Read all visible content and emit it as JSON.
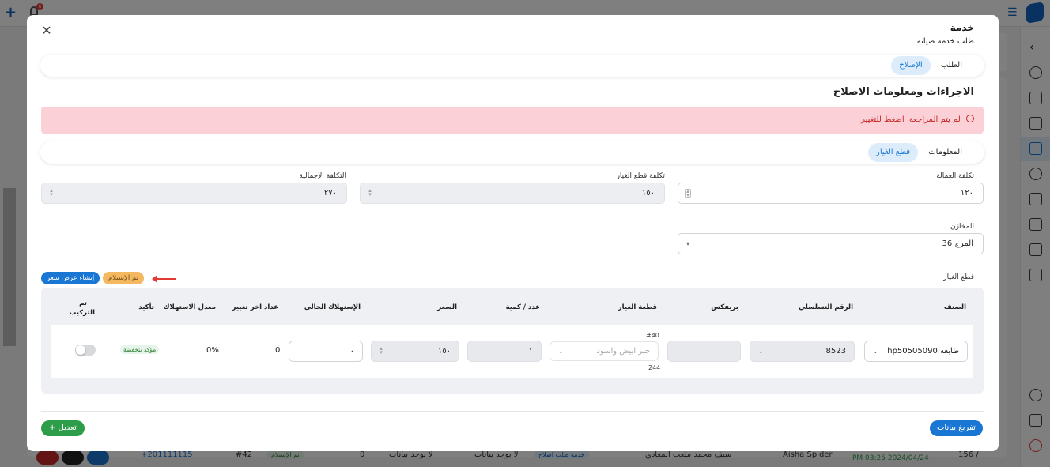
{
  "background": {
    "bell_badge": "6",
    "row": {
      "phone": "+201111115",
      "ticket": "#42",
      "status": "تم الإستلام",
      "count": "0",
      "no_data_1": "لا يوجد بيانات",
      "no_data_2": "لا يوجد بيانات",
      "service": "خدمة طلب اصلاح",
      "customer": "سيف محمد ملعب المعادي",
      "company": "Aisha Spider",
      "date": "PM 03:25 2024/04/24",
      "index": "156 /"
    }
  },
  "modal": {
    "title": "خدمة",
    "subtitle": "طلب خدمة صيانة",
    "tabs": [
      {
        "label": "الطلب"
      },
      {
        "label": "الإصلاح"
      }
    ],
    "section_title": "الاجراءات ومعلومات الاصلاح",
    "alert_text": "لم يتم المراجعة, اضغط للتغيير",
    "subtabs": [
      {
        "label": "المعلومات"
      },
      {
        "label": "قطع الغيار"
      }
    ],
    "labor_cost": {
      "label": "تكلفة العمالة",
      "value": "١٢٠"
    },
    "parts_cost": {
      "label": "تكلفة قطع الغيار",
      "value": "١٥٠"
    },
    "total_cost": {
      "label": "التكلفة الإجمالية",
      "value": "٢٧٠"
    },
    "warehouse": {
      "label": "المخازن",
      "value": "المرج 36"
    },
    "parts_label": "قطع الغيار",
    "received_badge": "تم الإستلام",
    "create_quote": "إنشاء عرض سعر",
    "table": {
      "headers": {
        "category": "الصنف",
        "serial": "الرقم التسلسلي",
        "prefix": "بريفكس",
        "part": "قطعة الغيار",
        "qty": "عدد / كمية",
        "price": "السعر",
        "current_consumption": "الإستهلاك الحالى",
        "last_change_counter": "عداد اخر تغيير",
        "consumption_rate": "معدل الاستهلاك",
        "confirm": "تأكيد",
        "installed": "تم التركيب"
      },
      "row": {
        "category": "طابعه hp50505090",
        "serial": "8523",
        "prefix": "",
        "part_top": "#40",
        "part_placeholder": "حبر ابيض واسود",
        "part_bottom": "244",
        "qty": "١",
        "price": "١٥٠",
        "current_consumption": "٠",
        "last_change_counter": "0",
        "consumption_rate": "0%",
        "confirm": "مؤكد بتخفضة"
      }
    },
    "edit_button": "تعديل",
    "unload_button": "تفريغ بيانات"
  }
}
